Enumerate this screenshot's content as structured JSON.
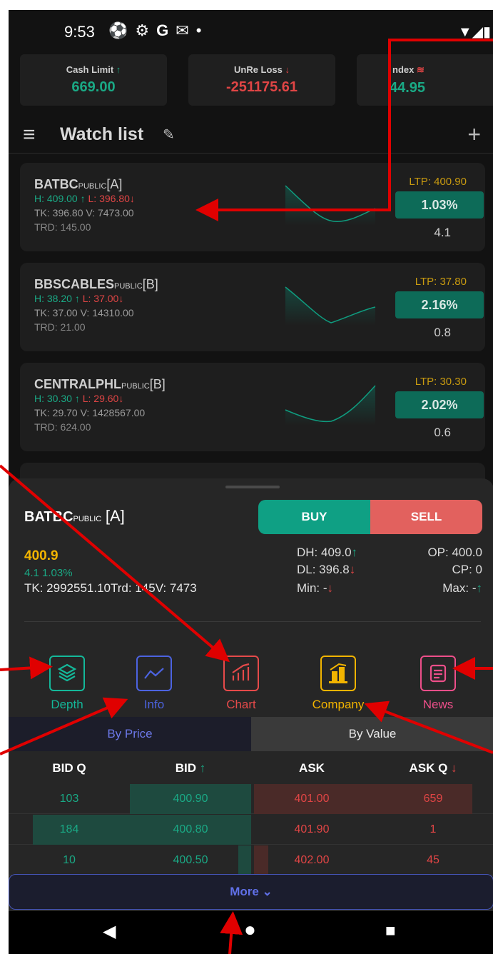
{
  "status_bar": {
    "time": "9:53"
  },
  "summary": {
    "cash_limit": {
      "label": "Cash Limit",
      "value": "669.00"
    },
    "unre_loss": {
      "label": "UnRe Loss",
      "value": "-251175.61"
    },
    "index": {
      "label": "ndex",
      "value": "44.95"
    }
  },
  "watchlist": {
    "title": "Watch list",
    "items": [
      {
        "symbol": "BATBC",
        "board": "PUBLIC",
        "group": "[A]",
        "high": "H: 409.00",
        "low": "L: 396.80",
        "tk_v": "TK: 396.80  V: 7473.00",
        "trd": "TRD: 145.00",
        "ltp": "LTP: 400.90",
        "pct": "1.03%",
        "change": "4.1"
      },
      {
        "symbol": "BBSCABLES",
        "board": "PUBLIC",
        "group": "[B]",
        "high": "H: 38.20",
        "low": "L: 37.00",
        "tk_v": "TK: 37.00  V: 14310.00",
        "trd": "TRD: 21.00",
        "ltp": "LTP: 37.80",
        "pct": "2.16%",
        "change": "0.8"
      },
      {
        "symbol": "CENTRALPHL",
        "board": "PUBLIC",
        "group": "[B]",
        "high": "H: 30.30",
        "low": "L: 29.60",
        "tk_v": "TK: 29.70  V: 1428567.00",
        "trd": "TRD: 624.00",
        "ltp": "LTP: 30.30",
        "pct": "2.02%",
        "change": "0.6"
      }
    ]
  },
  "detail": {
    "symbol": "BATBC",
    "board": "PUBLIC",
    "group": "[A]",
    "buy_label": "BUY",
    "sell_label": "SELL",
    "price": "400.9",
    "change": "4.1  1.03%",
    "tk_label": "TK: ",
    "tk_value": "2992551.10",
    "trd_label": "Trd: ",
    "trd_value": "145",
    "v_label": "V: ",
    "v_value": "7473",
    "dh": "DH: 409.0",
    "dl": "DL: 396.8",
    "min": "Min: -",
    "op": "OP: 400.0",
    "cp": "CP: 0",
    "max": "Max: -",
    "actions": {
      "depth": "Depth",
      "info": "Info",
      "chart": "Chart",
      "company": "Company",
      "news": "News"
    },
    "tabs": {
      "by_price": "By Price",
      "by_value": "By Value"
    },
    "orderbook": {
      "headers": {
        "bid_q": "BID Q",
        "bid": "BID",
        "ask": "ASK",
        "ask_q": "ASK Q"
      },
      "rows": [
        {
          "bid_q": "103",
          "bid": "400.90",
          "ask": "401.00",
          "ask_q": "659"
        },
        {
          "bid_q": "184",
          "bid": "400.80",
          "ask": "401.90",
          "ask_q": "1"
        },
        {
          "bid_q": "10",
          "bid": "400.50",
          "ask": "402.00",
          "ask_q": "45"
        }
      ]
    },
    "more_label": "More"
  },
  "colors": {
    "background": "#121212",
    "green": "#1aa985",
    "red": "#e04545",
    "ltp": "#c89a10",
    "buy": "#0fa084",
    "sell": "#e2615e",
    "accent": "#6070e8",
    "annotation": "#e00000"
  }
}
